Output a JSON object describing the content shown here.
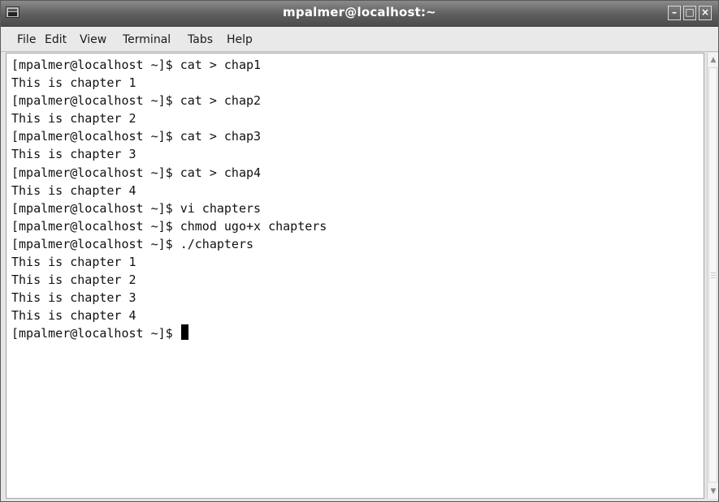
{
  "window": {
    "title": "mpalmer@localhost:~",
    "app_icon": "terminal-icon",
    "controls": [
      "minimize",
      "maximize",
      "close"
    ]
  },
  "menu": {
    "items": [
      {
        "key": "file",
        "label": "File"
      },
      {
        "key": "edit",
        "label": "Edit"
      },
      {
        "key": "view",
        "label": "View"
      },
      {
        "key": "terminal",
        "label": "Terminal"
      },
      {
        "key": "tabs",
        "label": "Tabs"
      },
      {
        "key": "help",
        "label": "Help"
      }
    ]
  },
  "terminal": {
    "lines": [
      "[mpalmer@localhost ~]$ cat > chap1",
      "This is chapter 1",
      "[mpalmer@localhost ~]$ cat > chap2",
      "This is chapter 2",
      "[mpalmer@localhost ~]$ cat > chap3",
      "This is chapter 3",
      "[mpalmer@localhost ~]$ cat > chap4",
      "This is chapter 4",
      "[mpalmer@localhost ~]$ vi chapters",
      "[mpalmer@localhost ~]$ chmod ugo+x chapters",
      "[mpalmer@localhost ~]$ ./chapters",
      "This is chapter 1",
      "This is chapter 2",
      "This is chapter 3",
      "This is chapter 4"
    ],
    "prompt": "[mpalmer@localhost ~]$ "
  }
}
